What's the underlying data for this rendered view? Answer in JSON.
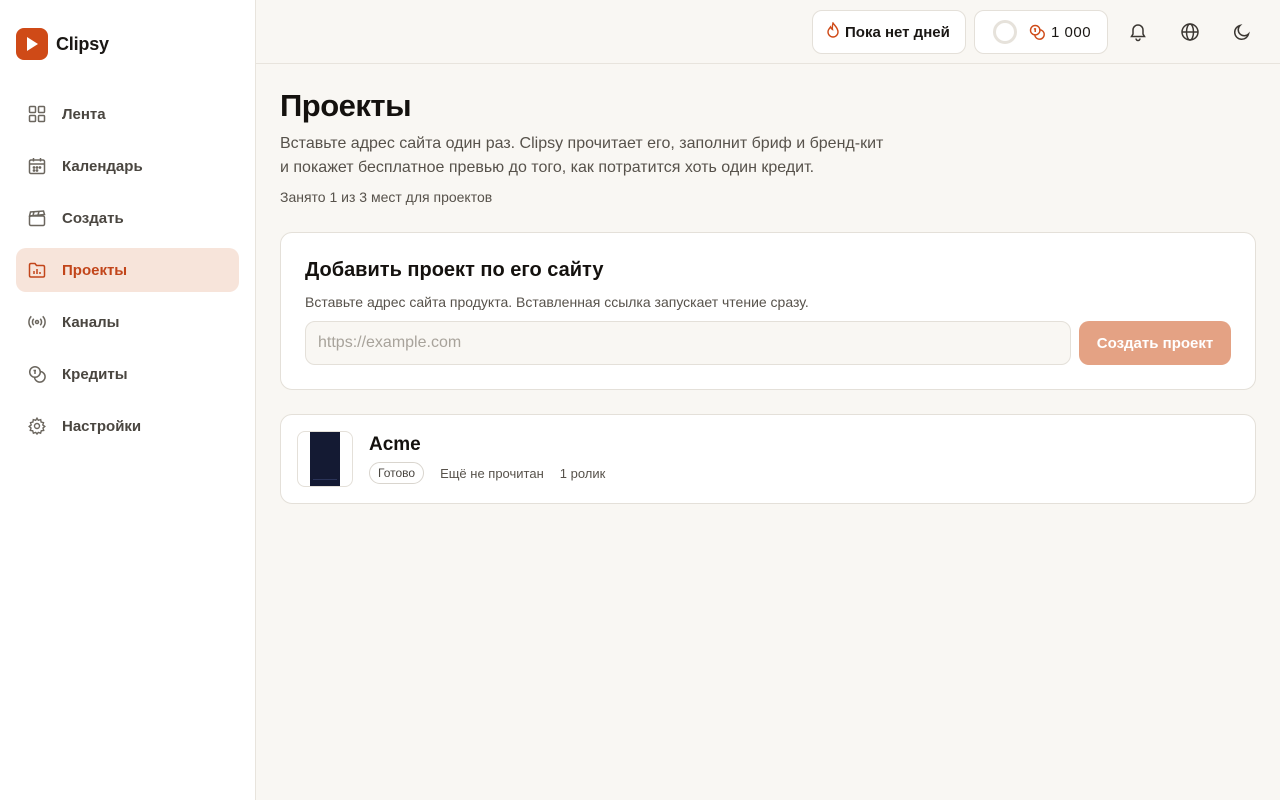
{
  "app": {
    "name": "Clipsy",
    "accent": "#cf4a17"
  },
  "sidebar": {
    "items": [
      {
        "label": "Лента",
        "icon": "grid-icon"
      },
      {
        "label": "Календарь",
        "icon": "calendar-icon"
      },
      {
        "label": "Создать",
        "icon": "clapperboard-icon"
      },
      {
        "label": "Проекты",
        "icon": "folder-chart-icon",
        "active": true
      },
      {
        "label": "Каналы",
        "icon": "broadcast-icon"
      },
      {
        "label": "Кредиты",
        "icon": "coins-icon"
      },
      {
        "label": "Настройки",
        "icon": "gear-icon"
      }
    ]
  },
  "topbar": {
    "streak_label": "Пока нет дней",
    "credits_value": "1 000",
    "icons": [
      "flame-icon",
      "progress-ring-icon",
      "coins-icon",
      "bell-icon",
      "globe-icon",
      "moon-icon"
    ]
  },
  "page": {
    "title": "Проекты",
    "description_line1": "Вставьте адрес сайта один раз. Clipsy прочитает его, заполнит бриф и бренд-кит",
    "description_line2": "и покажет бесплатное превью до того, как потратится хоть один кредит.",
    "slots_text": "Занято 1 из 3 мест для проектов"
  },
  "add_project": {
    "title": "Добавить проект по его сайту",
    "subtitle": "Вставьте адрес сайта продукта. Вставленная ссылка запускает чтение сразу.",
    "input_value": "",
    "input_placeholder": "https://example.com",
    "button_label": "Создать проект"
  },
  "projects": [
    {
      "name": "Acme",
      "status": "Готово",
      "read_state": "Ещё не прочитан",
      "clips": "1 ролик"
    }
  ]
}
